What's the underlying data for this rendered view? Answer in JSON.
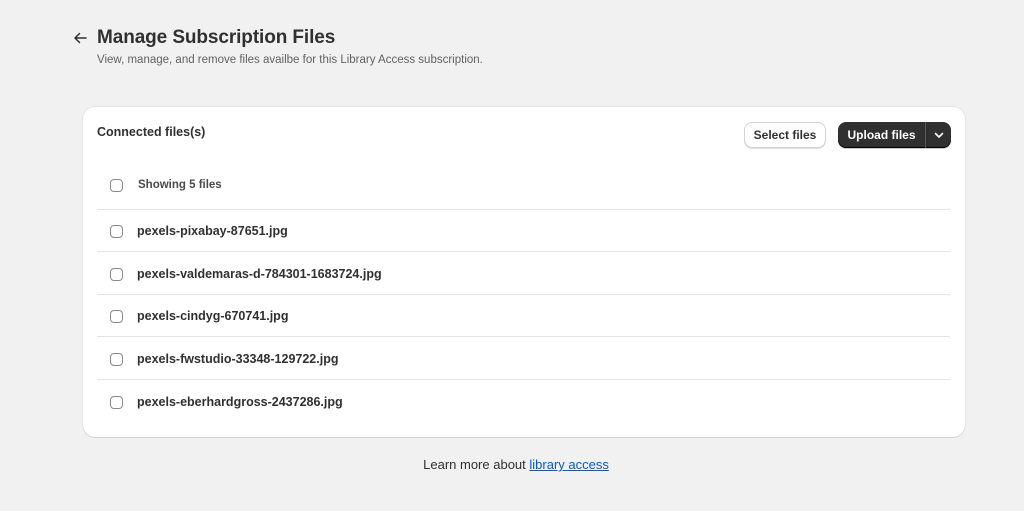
{
  "header": {
    "title": "Manage Subscription Files",
    "subtitle": "View, manage, and remove files availbe for this Library Access subscription."
  },
  "card": {
    "title": "Connected files(s)",
    "select_files_label": "Select files",
    "upload_files_label": "Upload files",
    "showing_label": "Showing 5 files",
    "files": [
      {
        "name": "pexels-pixabay-87651.jpg",
        "checked": false
      },
      {
        "name": "pexels-valdemaras-d-784301-1683724.jpg",
        "checked": false
      },
      {
        "name": "pexels-cindyg-670741.jpg",
        "checked": false
      },
      {
        "name": "pexels-fwstudio-33348-129722.jpg",
        "checked": false
      },
      {
        "name": "pexels-eberhardgross-2437286.jpg",
        "checked": false
      }
    ]
  },
  "footer": {
    "text": "Learn more about ",
    "link_text": "library access"
  },
  "icons": {
    "back": "arrow-left-icon",
    "chevron": "chevron-down-icon"
  },
  "colors": {
    "background": "#f1f1f1",
    "primary_button": "#303030",
    "link": "#005bd3"
  }
}
